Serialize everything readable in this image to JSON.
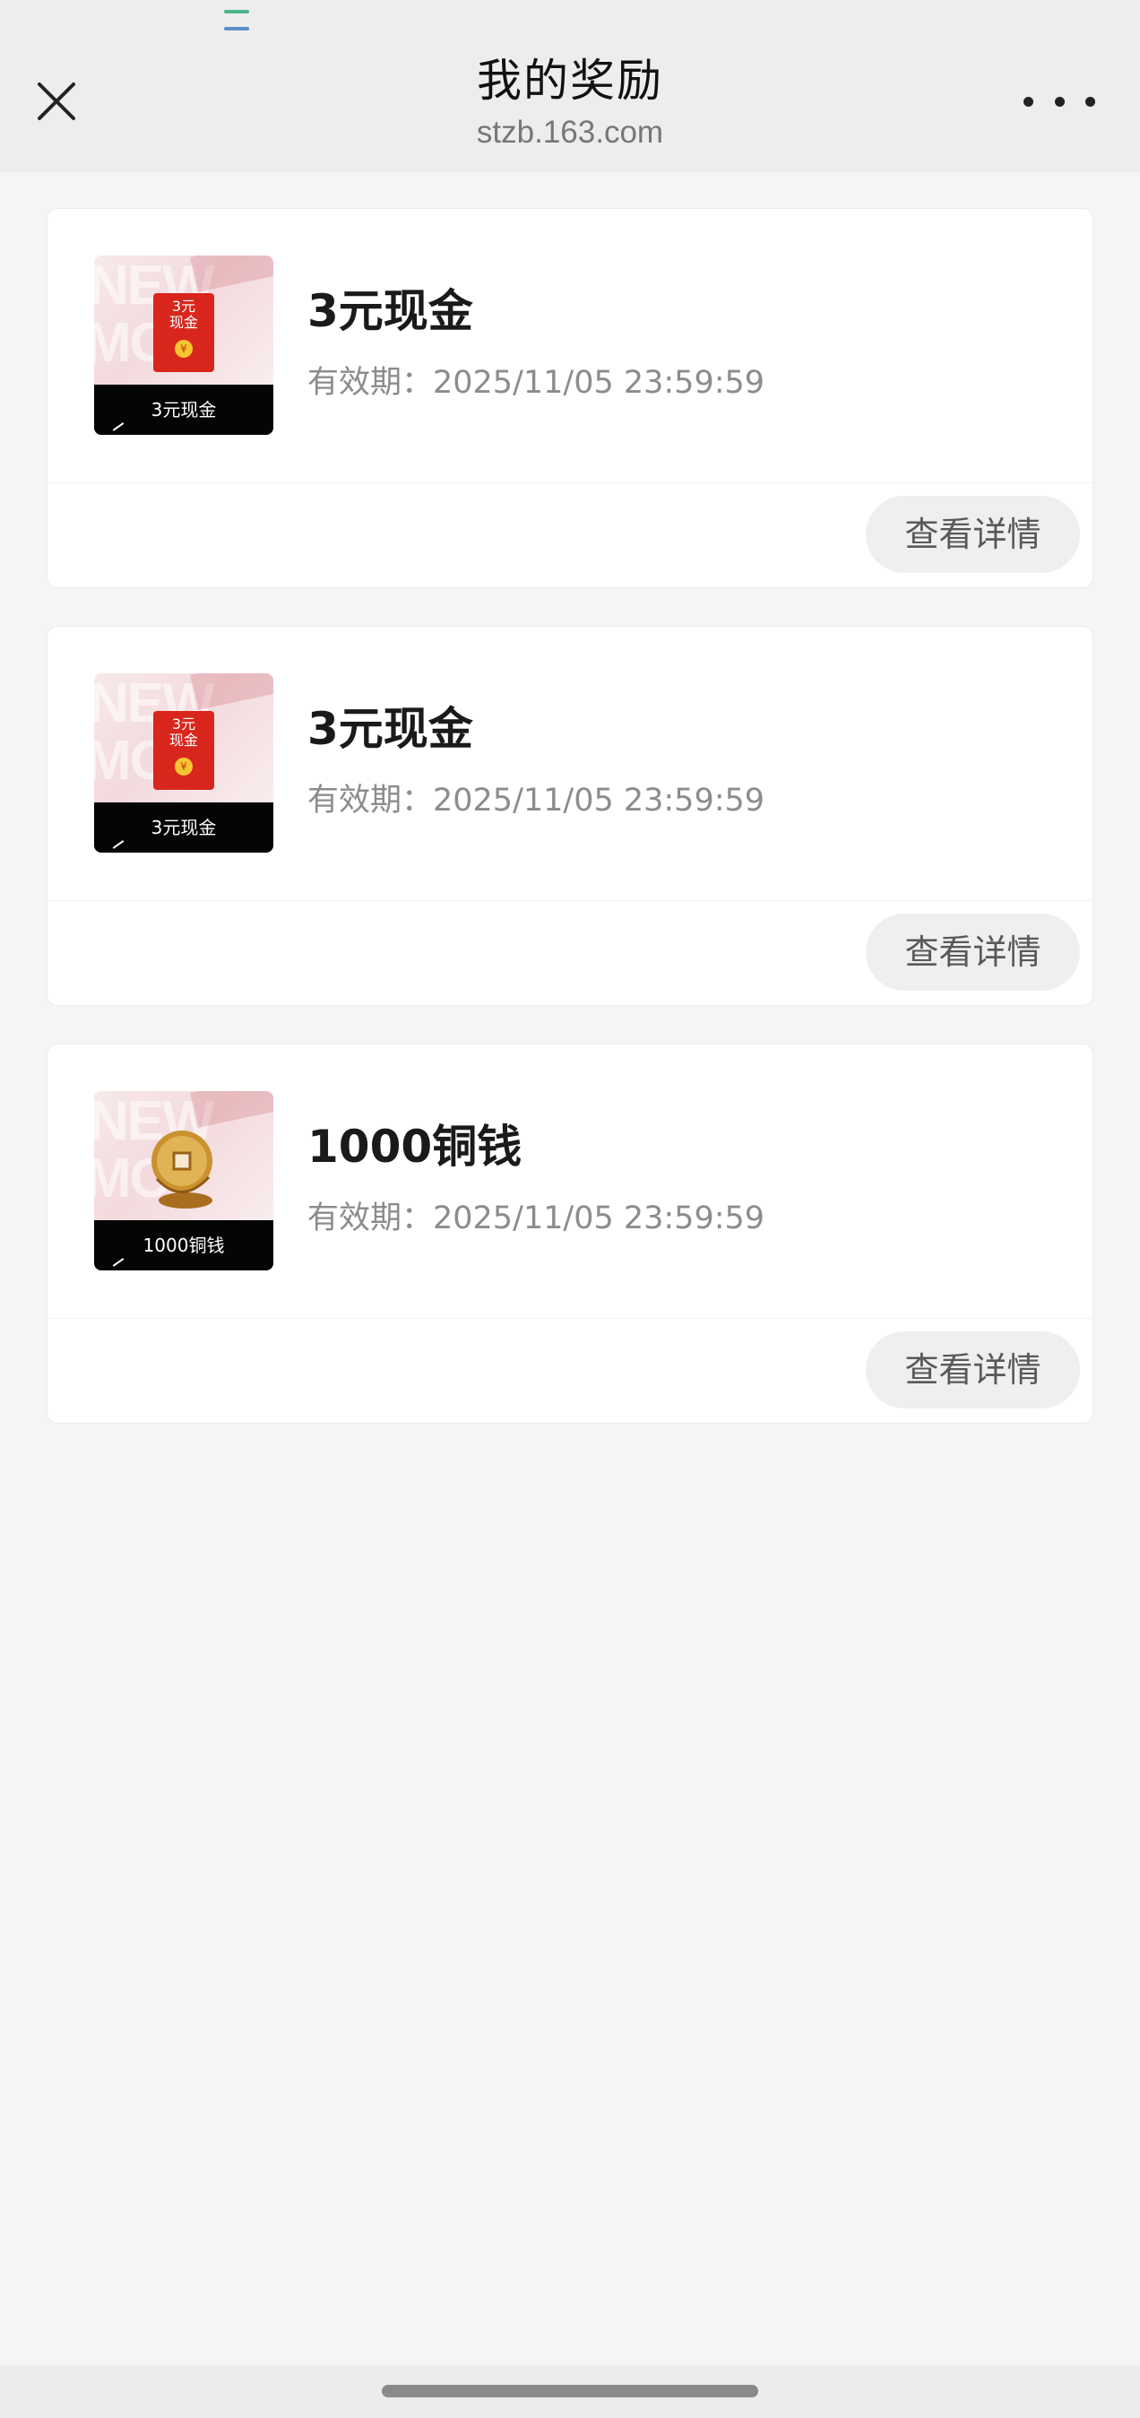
{
  "header": {
    "title": "我的奖励",
    "url": "stzb.163.com",
    "close_icon": "close-icon",
    "more_icon": "more-icon"
  },
  "rewards": [
    {
      "name": "3元现金",
      "expiry": "有效期：2025/11/05 23:59:59",
      "thumb_caption": "3元现金",
      "thumb_label": "3元\n现金",
      "thumb_icon": "red-envelope-icon",
      "detail_label": "查看详情"
    },
    {
      "name": "3元现金",
      "expiry": "有效期：2025/11/05 23:59:59",
      "thumb_caption": "3元现金",
      "thumb_label": "3元\n现金",
      "thumb_icon": "red-envelope-icon",
      "detail_label": "查看详情"
    },
    {
      "name": "1000铜钱",
      "expiry": "有效期：2025/11/05 23:59:59",
      "thumb_caption": "1000铜钱",
      "thumb_icon": "copper-coin-icon",
      "detail_label": "查看详情"
    }
  ],
  "colors": {
    "header_bg": "#ededed",
    "page_bg": "#f5f5f5",
    "envelope_red": "#d9261c",
    "coin_gold": "#c9922e"
  }
}
